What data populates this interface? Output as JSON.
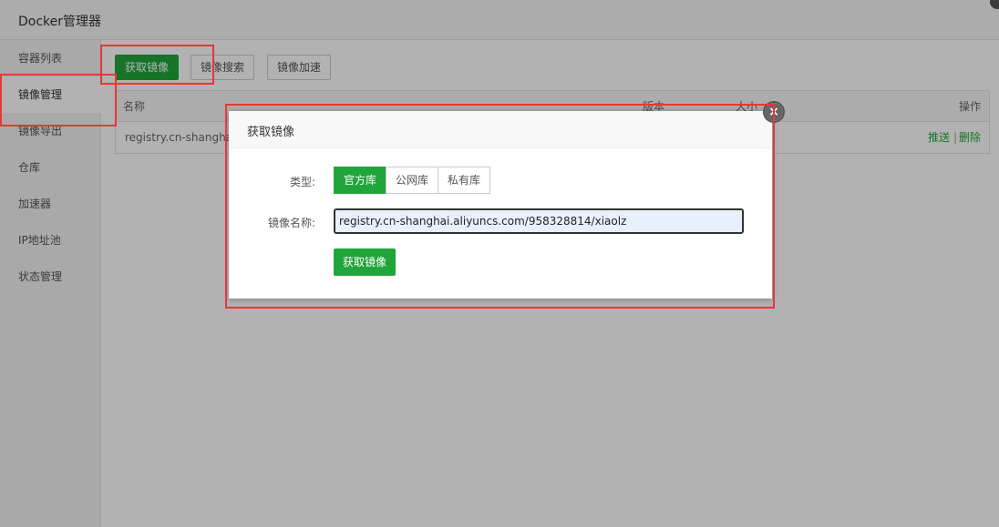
{
  "window": {
    "title": "Docker管理器"
  },
  "sidebar": {
    "items": [
      {
        "label": "容器列表"
      },
      {
        "label": "镜像管理"
      },
      {
        "label": "镜像导出"
      },
      {
        "label": "仓库"
      },
      {
        "label": "加速器"
      },
      {
        "label": "IP地址池"
      },
      {
        "label": "状态管理"
      }
    ]
  },
  "toolbar": {
    "pull_label": "获取镜像",
    "search_label": "镜像搜索",
    "accelerate_label": "镜像加速"
  },
  "table": {
    "headers": {
      "name": "名称",
      "version": "版本",
      "size": "大小",
      "actions": "操作"
    },
    "rows": [
      {
        "name": "registry.cn-shanghai",
        "push": "推送",
        "sep": "|",
        "delete": "删除"
      }
    ]
  },
  "dialog": {
    "title": "获取镜像",
    "type_label": "类型:",
    "type_options": [
      "官方库",
      "公网库",
      "私有库"
    ],
    "name_label": "镜像名称:",
    "name_value": "registry.cn-shanghai.aliyuncs.com/958328814/xiaolz",
    "submit_label": "获取镜像",
    "close_glyph": "×"
  },
  "colors": {
    "accent": "#20a53a",
    "highlight": "#e53935"
  }
}
